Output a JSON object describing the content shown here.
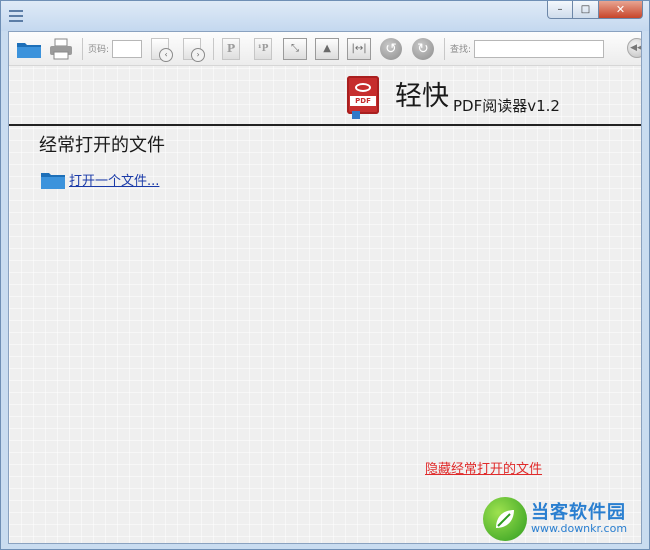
{
  "window": {
    "controls": {
      "minimize": "–",
      "maximize": "□",
      "close": "✕"
    }
  },
  "toolbar": {
    "page_label": "页码:",
    "page_value": "",
    "find_label": "查找:",
    "find_value": ""
  },
  "brand": {
    "logo_text": "PDF",
    "title": "轻快",
    "subtitle": "PDF阅读器v1.2"
  },
  "main": {
    "recent_title": "经常打开的文件",
    "open_file_link": "打开一个文件...",
    "hide_link": "隐藏经常打开的文件"
  },
  "watermark": {
    "name": "当客软件园",
    "url": "www.downkr.com"
  },
  "colors": {
    "link_blue": "#1a3aa8",
    "hide_red": "#e02a2a",
    "pdf_red": "#c62d2d",
    "watermark_blue": "#2a7fd0"
  }
}
